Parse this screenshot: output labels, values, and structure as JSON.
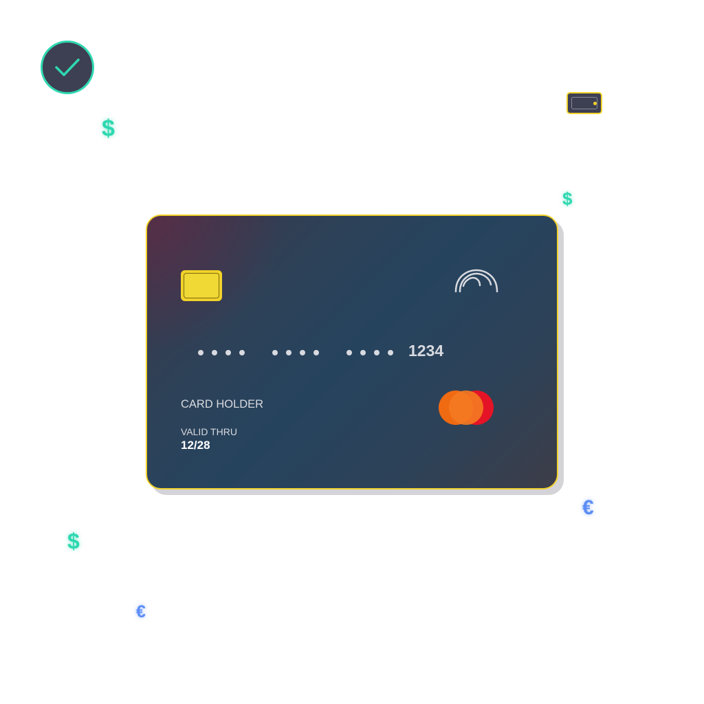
{
  "icons": {
    "check": "check-icon",
    "wallet": "wallet-icon",
    "contactless": "contactless-icon",
    "brand": "mastercard-logo"
  },
  "currency_symbols": {
    "dollar": "$",
    "euro": "€"
  },
  "card": {
    "masked_groups": [
      "••••",
      "••••",
      "••••"
    ],
    "last4": "1234",
    "holder_label": "CARD HOLDER",
    "valid_label": "VALID THRU",
    "valid_value": "12/28"
  },
  "colors": {
    "accent_teal": "#2ed8b0",
    "accent_yellow": "#f2d22a",
    "euro_blue": "#5b8df5",
    "card_dark": "#26435e",
    "mastercard_orange": "#f06a12",
    "mastercard_red": "#e41426"
  }
}
